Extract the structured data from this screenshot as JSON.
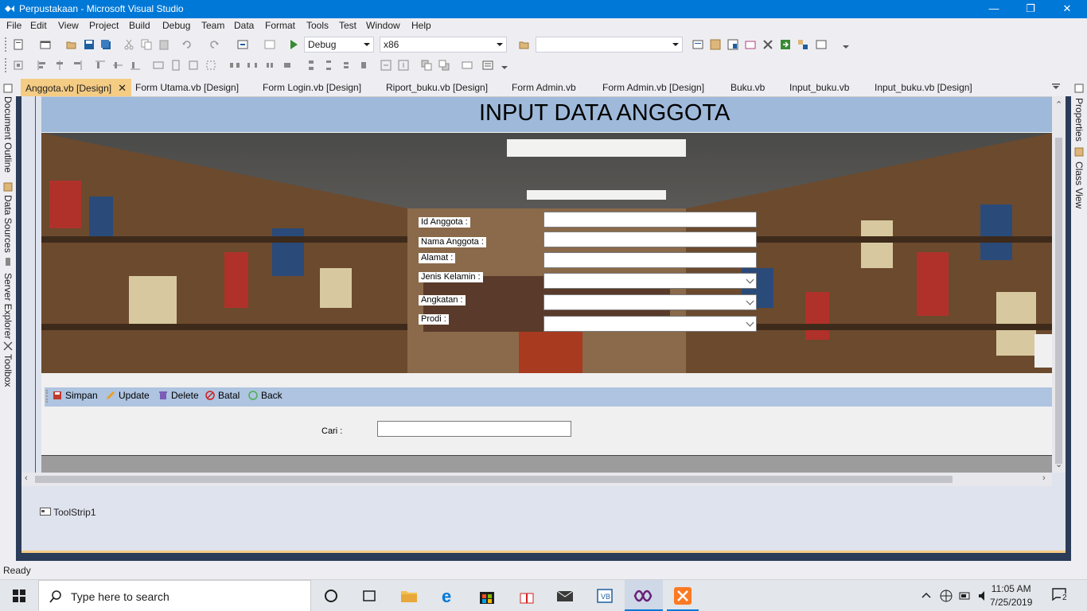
{
  "window": {
    "title": "Perpustakaan - Microsoft Visual Studio",
    "minimize": "—",
    "restore": "❐",
    "close": "✕"
  },
  "menu": [
    "File",
    "Edit",
    "View",
    "Project",
    "Build",
    "Debug",
    "Team",
    "Data",
    "Format",
    "Tools",
    "Test",
    "Window",
    "Help"
  ],
  "toolbar": {
    "configuration": "Debug",
    "platform": "x86",
    "find_value": ""
  },
  "left_dock_tabs": [
    "Document Outline",
    "Data Sources",
    "Server Explorer",
    "Toolbox"
  ],
  "right_dock_tabs": [
    "Properties",
    "Class View"
  ],
  "tabs": [
    {
      "label": "Anggota.vb [Design]",
      "active": true
    },
    {
      "label": "Form Utama.vb [Design]"
    },
    {
      "label": "Form Login.vb [Design]"
    },
    {
      "label": "Riport_buku.vb [Design]"
    },
    {
      "label": "Form Admin.vb"
    },
    {
      "label": "Form Admin.vb [Design]"
    },
    {
      "label": "Buku.vb"
    },
    {
      "label": "Input_buku.vb"
    },
    {
      "label": "Input_buku.vb [Design]"
    }
  ],
  "tab_close": "✕",
  "form": {
    "header_title": "INPUT DATA ANGGOTA",
    "fields": [
      {
        "label": "Id Anggota :",
        "type": "text"
      },
      {
        "label": "Nama Anggota :",
        "type": "text"
      },
      {
        "label": "Alamat :",
        "type": "text"
      },
      {
        "label": "Jenis Kelamin :",
        "type": "combo"
      },
      {
        "label": "Angkatan :",
        "type": "combo"
      },
      {
        "label": "Prodi :",
        "type": "combo"
      }
    ],
    "actions": [
      "Simpan",
      "Update",
      "Delete",
      "Batal",
      "Back"
    ],
    "search_label": "Cari :"
  },
  "component_tray": {
    "item": "ToolStrip1"
  },
  "status": "Ready",
  "taskbar": {
    "search_placeholder": "Type here to search",
    "time": "11:05 AM",
    "date": "7/25/2019",
    "notifications": "2"
  },
  "colors": {
    "title_bar": "#0078d7",
    "active_tab": "#f5cc84",
    "form_header": "#9eb9d9",
    "action_bar": "#aec4e0"
  }
}
